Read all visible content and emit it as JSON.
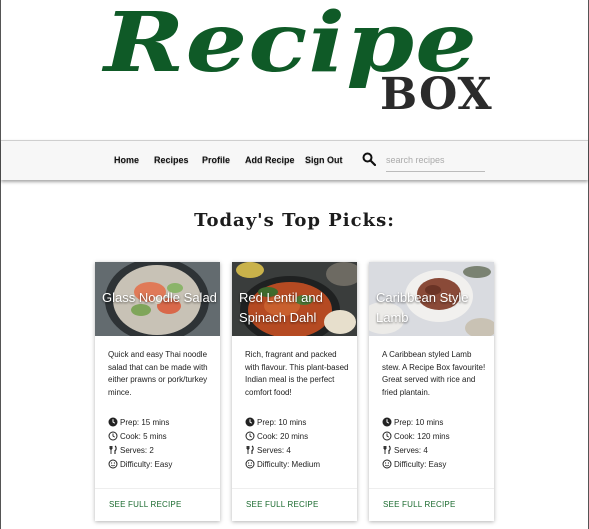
{
  "logo": {
    "primary": "Recipe",
    "secondary": "BOX"
  },
  "nav": {
    "items": [
      {
        "label": "Home"
      },
      {
        "label": "Recipes"
      },
      {
        "label": "Profile"
      },
      {
        "label": "Add Recipe"
      },
      {
        "label": "Sign Out"
      }
    ],
    "search_placeholder": "search recipes"
  },
  "heading": "Today's Top Picks:",
  "cards": [
    {
      "title": "Glass Noodle Salad",
      "description": "Quick and easy Thai noodle salad that can be made with either prawns or pork/turkey mince.",
      "prep": "Prep: 15 mins",
      "cook": "Cook: 5 mins",
      "serves": "Serves: 2",
      "difficulty": "Difficulty: Easy",
      "link": "SEE FULL RECIPE"
    },
    {
      "title": "Red Lentil and Spinach Dahl",
      "description": "Rich, fragrant and packed with flavour. This plant-based Indian meal is the perfect comfort food!",
      "prep": "Prep: 10 mins",
      "cook": "Cook: 20 mins",
      "serves": "Serves: 4",
      "difficulty": "Difficulty: Medium",
      "link": "SEE FULL RECIPE"
    },
    {
      "title": "Caribbean Style Lamb",
      "description": "A Caribbean styled Lamb stew. A Recipe Box favourite! Great served with rice and fried plantain.",
      "prep": "Prep: 10 mins",
      "cook": "Cook: 120 mins",
      "serves": "Serves: 4",
      "difficulty": "Difficulty: Easy",
      "link": "SEE FULL RECIPE"
    }
  ],
  "colors": {
    "brand_green": "#0f5a27",
    "link_green": "#1a6a2e",
    "logo_dark": "#2b2b2b",
    "navbar_bg": "#f7f7f7"
  },
  "icons": [
    "search-icon",
    "clock-filled-icon",
    "clock-outline-icon",
    "utensils-icon",
    "smiley-icon"
  ]
}
